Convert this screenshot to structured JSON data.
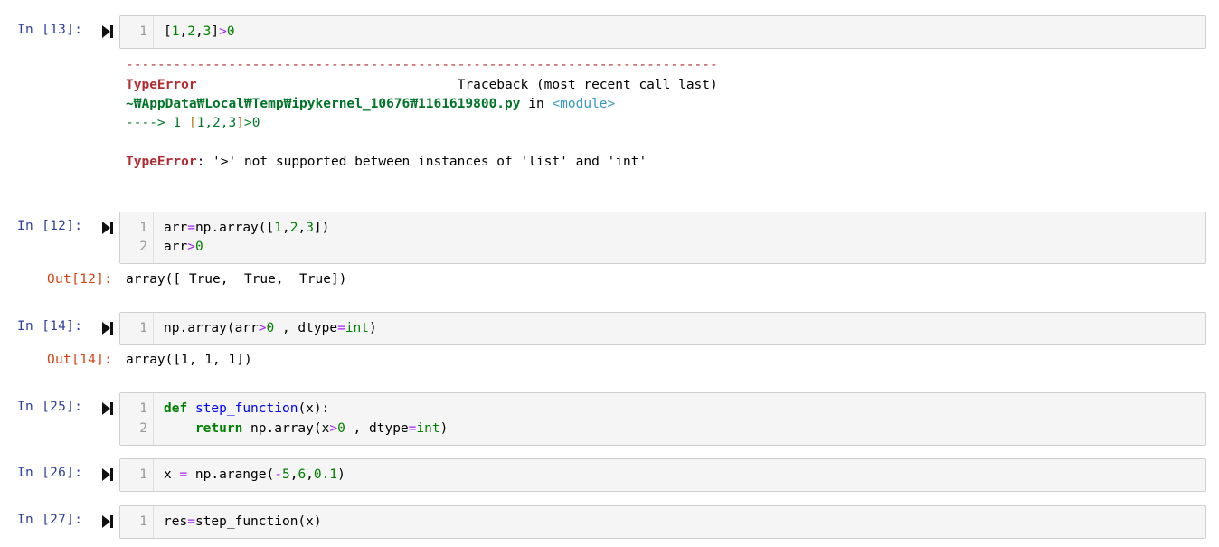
{
  "cells": [
    {
      "prompt": "In [13]:",
      "lines": [
        {
          "no": "1",
          "tokens": [
            {
              "t": "[",
              "c": ""
            },
            {
              "t": "1",
              "c": "num"
            },
            {
              "t": ",",
              "c": ""
            },
            {
              "t": "2",
              "c": "num"
            },
            {
              "t": ",",
              "c": ""
            },
            {
              "t": "3",
              "c": "num"
            },
            {
              "t": "]",
              "c": ""
            },
            {
              "t": ">",
              "c": "op"
            },
            {
              "t": "0",
              "c": "num"
            }
          ]
        }
      ],
      "traceback": {
        "dashes": "---------------------------------------------------------------------------",
        "error_name": "TypeError",
        "header_right": "                                 Traceback (most recent call last)",
        "file_path": "~₩AppData₩Local₩Temp₩ipykernel_10676₩1161619800.py",
        "in_word": " in ",
        "module": "<module>",
        "arrow": "----> 1 ",
        "arrow_code_tokens": [
          {
            "t": "[",
            "c": "olive"
          },
          {
            "t": "1",
            "c": "grn"
          },
          {
            "t": ",",
            "c": "grn"
          },
          {
            "t": "2",
            "c": "grn"
          },
          {
            "t": ",",
            "c": "grn"
          },
          {
            "t": "3",
            "c": "grn"
          },
          {
            "t": "]",
            "c": "olive"
          },
          {
            "t": ">",
            "c": "grn"
          },
          {
            "t": "0",
            "c": "grn"
          }
        ],
        "final_error_name": "TypeError",
        "final_message": ": '>' not supported between instances of 'list' and 'int'"
      }
    },
    {
      "prompt": "In [12]:",
      "lines": [
        {
          "no": "1",
          "tokens": [
            {
              "t": "arr",
              "c": ""
            },
            {
              "t": "=",
              "c": "op"
            },
            {
              "t": "np.array([",
              "c": ""
            },
            {
              "t": "1",
              "c": "num"
            },
            {
              "t": ",",
              "c": ""
            },
            {
              "t": "2",
              "c": "num"
            },
            {
              "t": ",",
              "c": ""
            },
            {
              "t": "3",
              "c": "num"
            },
            {
              "t": "])",
              "c": ""
            }
          ]
        },
        {
          "no": "2",
          "tokens": [
            {
              "t": "arr",
              "c": ""
            },
            {
              "t": ">",
              "c": "op"
            },
            {
              "t": "0",
              "c": "num"
            }
          ]
        }
      ],
      "out_prompt": "Out[12]:",
      "output": "array([ True,  True,  True])"
    },
    {
      "prompt": "In [14]:",
      "lines": [
        {
          "no": "1",
          "tokens": [
            {
              "t": "np.array(arr",
              "c": ""
            },
            {
              "t": ">",
              "c": "op"
            },
            {
              "t": "0",
              "c": "num"
            },
            {
              "t": " , dtype",
              "c": ""
            },
            {
              "t": "=",
              "c": "op"
            },
            {
              "t": "int",
              "c": "bi"
            },
            {
              "t": ")",
              "c": ""
            }
          ]
        }
      ],
      "out_prompt": "Out[14]:",
      "output": "array([1, 1, 1])"
    },
    {
      "prompt": "In [25]:",
      "lines": [
        {
          "no": "1",
          "tokens": [
            {
              "t": "def",
              "c": "kw"
            },
            {
              "t": " ",
              "c": ""
            },
            {
              "t": "step_function",
              "c": "fn"
            },
            {
              "t": "(x):",
              "c": ""
            }
          ]
        },
        {
          "no": "2",
          "tokens": [
            {
              "t": "    ",
              "c": ""
            },
            {
              "t": "return",
              "c": "kw"
            },
            {
              "t": " np.array(x",
              "c": ""
            },
            {
              "t": ">",
              "c": "op"
            },
            {
              "t": "0",
              "c": "num"
            },
            {
              "t": " , dtype",
              "c": ""
            },
            {
              "t": "=",
              "c": "op"
            },
            {
              "t": "int",
              "c": "bi"
            },
            {
              "t": ")",
              "c": ""
            }
          ]
        }
      ]
    },
    {
      "prompt": "In [26]:",
      "lines": [
        {
          "no": "1",
          "tokens": [
            {
              "t": "x ",
              "c": ""
            },
            {
              "t": "=",
              "c": "op"
            },
            {
              "t": " np.arange(",
              "c": ""
            },
            {
              "t": "-",
              "c": "op"
            },
            {
              "t": "5",
              "c": "num"
            },
            {
              "t": ",",
              "c": ""
            },
            {
              "t": "6",
              "c": "num"
            },
            {
              "t": ",",
              "c": ""
            },
            {
              "t": "0.1",
              "c": "num"
            },
            {
              "t": ")",
              "c": ""
            }
          ]
        }
      ]
    },
    {
      "prompt": "In [27]:",
      "lines": [
        {
          "no": "1",
          "tokens": [
            {
              "t": "res",
              "c": ""
            },
            {
              "t": "=",
              "c": "op"
            },
            {
              "t": "step_function(x)",
              "c": ""
            }
          ]
        }
      ]
    }
  ],
  "icons": {
    "run": "run-cell-icon"
  }
}
